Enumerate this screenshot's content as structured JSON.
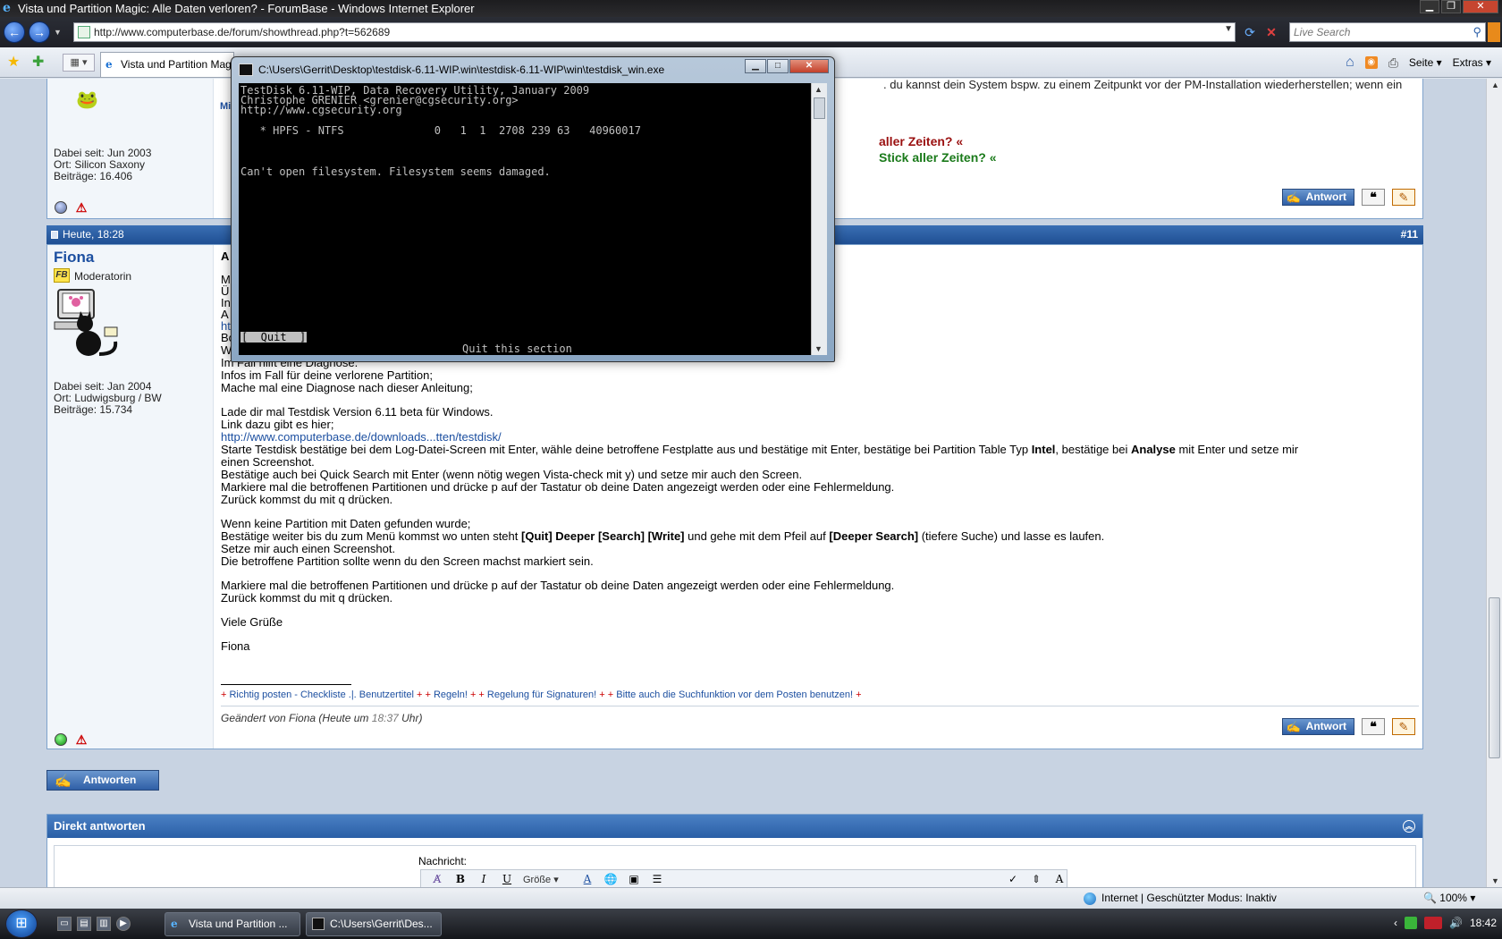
{
  "window": {
    "title": "Vista und Partition Magic: Alle Daten verloren? - ForumBase - Windows Internet Explorer",
    "minimize": "▁",
    "restore": "❐",
    "close": "✕"
  },
  "nav": {
    "back": "←",
    "forward": "→",
    "dropdown": "▼",
    "url": "http://www.computerbase.de/forum/showthread.php?t=562689",
    "refresh": "⟳",
    "stop": "✕",
    "search_placeholder": "Live Search"
  },
  "tabs": {
    "active_label": "Vista und Partition Magic...",
    "home": "⌂",
    "rss": "◉",
    "print": "⎙",
    "seite": "Seite ▾",
    "extras": "Extras ▾"
  },
  "post10": {
    "top_text": ". du kannst dein System bspw. zu einem Zeitpunkt vor der PM-Installation wiederherstellen; wenn ein",
    "dabei_seit": "Dabei seit: Jun 2003",
    "ort": "Ort: Silicon Saxony",
    "beitraege": "Beiträge: 16.406",
    "sig_line1": "aller Zeiten? «",
    "sig_line2": "Stick aller Zeiten? «",
    "antwort": "Antwort"
  },
  "post11": {
    "date": "Heute, 18:28",
    "number": "#11",
    "username": "Fiona",
    "badge": "FB",
    "rank": "Moderatorin",
    "dabei_seit": "Dabei seit: Jan 2004",
    "ort": "Ort: Ludwigsburg / BW",
    "beitraege": "Beiträge: 15.734",
    "partial_lines": [
      "A",
      "M",
      "Ü",
      "In",
      "A",
      "ht"
    ],
    "line_boot": "Boot und Partitionsprobleme sind zwei paar Schuhe.",
    "lines_a": [
      "Wenn PM deine Partition zerschossen hat, sind auch Vista-Reparaturen nicht hilfreich.",
      "Im Fall hilft eine Diagnose.",
      "Infos im Fall für deine verlorene Partition;",
      "Mache mal eine Diagnose nach dieser Anleitung;"
    ],
    "lines_b": [
      "Lade dir mal Testdisk Version 6.11 beta für Windows.",
      "Link dazu gibt es hier;"
    ],
    "link": "http://www.computerbase.de/downloads...tten/testdisk/",
    "line_starte_1": "Starte Testdisk bestätige bei dem Log-Datei-Screen mit Enter, wähle deine betroffene Festplatte aus und bestätige mit Enter, bestätige bei Partition Table Typ ",
    "line_starte_intel": "Intel",
    "line_starte_2": ", bestätige bei ",
    "line_starte_analyse": "Analyse",
    "line_starte_3": " mit Enter und setze mir",
    "line_screenshot": "einen Screenshot.",
    "lines_c": [
      "Bestätige auch bei Quick Search mit Enter (wenn nötig wegen Vista-check mit y) und setze mir auch den Screen.",
      "Markiere mal die betroffenen Partitionen und drücke p auf der Tastatur ob deine Daten angezeigt werden oder eine Fehlermeldung.",
      "Zurück kommst du mit q drücken."
    ],
    "line_keine": "Wenn keine Partition mit Daten gefunden wurde;",
    "line_bestaetige_1": "Bestätige weiter bis du zum Menü kommst wo unten steht ",
    "line_bestaetige_b1": "[Quit] Deeper [Search] [Write]",
    "line_bestaetige_2": " und gehe mit dem Pfeil auf ",
    "line_bestaetige_b2": "[Deeper Search]",
    "line_bestaetige_3": " (tiefere Suche) und lasse es laufen.",
    "lines_d": [
      "Setze mir auch einen Screenshot.",
      "Die betroffene Partition sollte wenn du den Screen machst markiert sein."
    ],
    "lines_e": [
      "Markiere mal die betroffenen Partitionen und drücke p auf der Tastatur ob deine Daten angezeigt werden oder eine Fehlermeldung.",
      "Zurück kommst du mit q drücken."
    ],
    "gruss": "Viele Grüße",
    "name": "Fiona",
    "sig": [
      "Richtig posten - Checkliste .|. Benutzertitel",
      "Regeln!",
      "Regelung für Signaturen!",
      "Bitte auch die Suchfunktion vor dem Posten benutzen!"
    ],
    "edit_prefix": "Geändert von Fiona (Heute um ",
    "edit_time": "18:37",
    "edit_suffix": " Uhr)",
    "antwort": "Antwort"
  },
  "reply": {
    "antworten": "Antworten",
    "direkt_antworten": "Direkt antworten",
    "nachricht": "Nachricht:",
    "groesse": "Größe"
  },
  "console": {
    "title": "C:\\Users\\Gerrit\\Desktop\\testdisk-6.11-WIP.win\\testdisk-6.11-WIP\\win\\testdisk_win.exe",
    "lines": [
      "TestDisk 6.11-WIP, Data Recovery Utility, January 2009",
      "Christophe GRENIER <grenier@cgsecurity.org>",
      "http://www.cgsecurity.org",
      "   * HPFS - NTFS              0   1  1  2708 239 63   40960017",
      "Can't open filesystem. Filesystem seems damaged."
    ],
    "quit": "[  Quit  ]",
    "hint": "Quit this section"
  },
  "status": {
    "zone": "Internet | Geschützter Modus: Inaktiv",
    "zoom": "100%"
  },
  "taskbar": {
    "task1": "Vista und Partition ...",
    "task2": "C:\\Users\\Gerrit\\Des...",
    "clock": "18:42"
  }
}
